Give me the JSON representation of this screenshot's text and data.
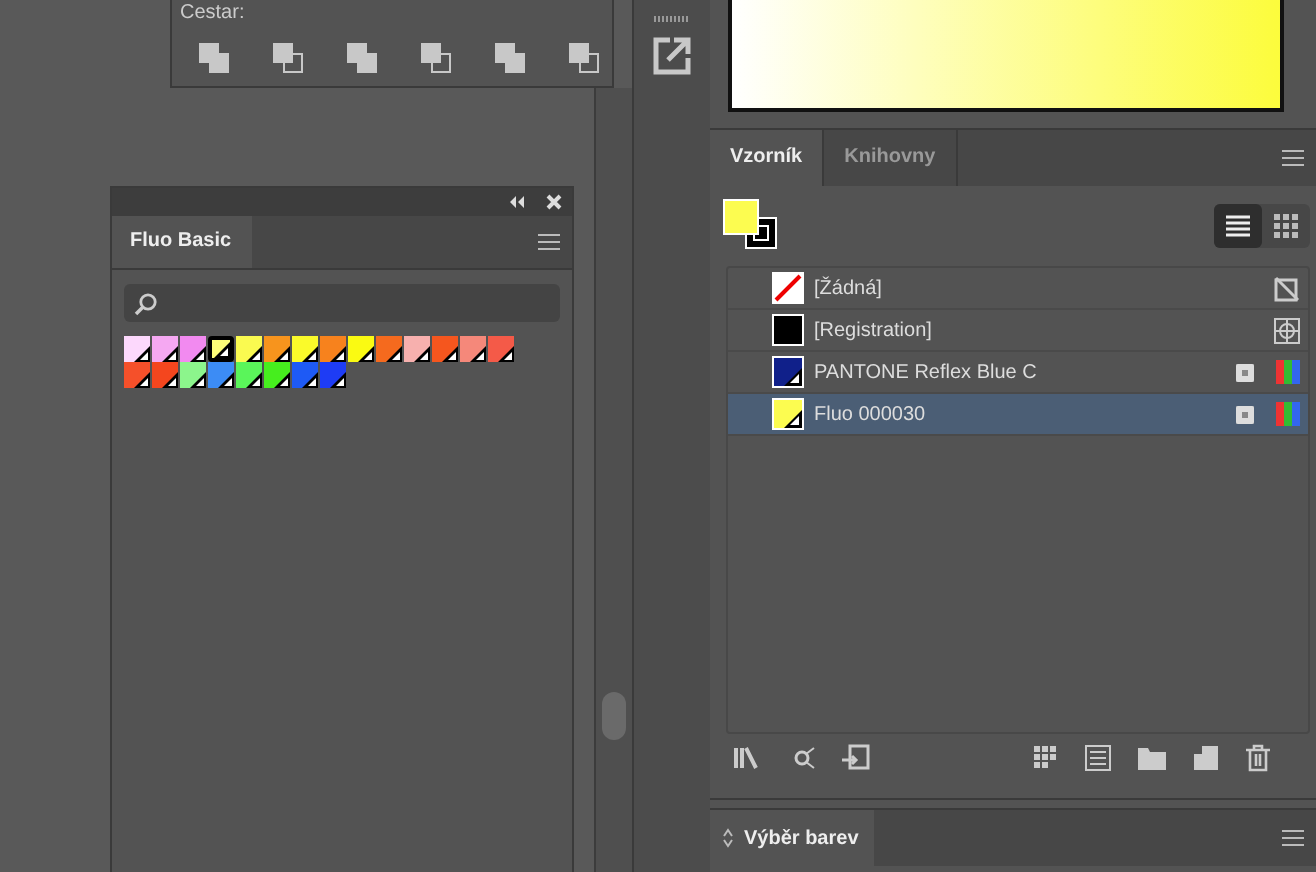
{
  "pathfinder_panel": {
    "label": "Cestar:"
  },
  "fluo_panel": {
    "tab": "Fluo Basic",
    "swatches": [
      {
        "color": "#fcd8fc",
        "selected": false
      },
      {
        "color": "#f5a8f2",
        "selected": false
      },
      {
        "color": "#f28af0",
        "selected": false
      },
      {
        "color": "#fcfc78",
        "selected": true
      },
      {
        "color": "#fafa50",
        "selected": false
      },
      {
        "color": "#f7941d",
        "selected": false
      },
      {
        "color": "#fafa2a",
        "selected": false
      },
      {
        "color": "#f7821d",
        "selected": false
      },
      {
        "color": "#fafa12",
        "selected": false
      },
      {
        "color": "#f56a1e",
        "selected": false
      },
      {
        "color": "#f7b0ae",
        "selected": false
      },
      {
        "color": "#f5561e",
        "selected": false
      },
      {
        "color": "#f5887a",
        "selected": false
      },
      {
        "color": "#f45a48",
        "selected": false
      },
      {
        "color": "#f5502a",
        "selected": false
      },
      {
        "color": "#f4461e",
        "selected": false
      },
      {
        "color": "#8cf58c",
        "selected": false
      },
      {
        "color": "#3c8cf5",
        "selected": false
      },
      {
        "color": "#5af55a",
        "selected": false
      },
      {
        "color": "#46ee1e",
        "selected": false
      },
      {
        "color": "#1e5af5",
        "selected": false
      },
      {
        "color": "#1e3cf5",
        "selected": false
      }
    ]
  },
  "swatches_panel": {
    "tabs": [
      {
        "label": "Vzorník",
        "selected": true
      },
      {
        "label": "Knihovny",
        "selected": false
      }
    ],
    "view": {
      "list_selected": true
    },
    "items": [
      {
        "name": "[Žádná]",
        "kind": "none",
        "color": "#ffffff",
        "selected": false
      },
      {
        "name": "[Registration]",
        "kind": "registration",
        "color": "#000000",
        "selected": false
      },
      {
        "name": "PANTONE Reflex Blue C",
        "kind": "spot",
        "color": "#10208a",
        "selected": false
      },
      {
        "name": "Fluo 000030",
        "kind": "spot",
        "color": "#fcfc50",
        "selected": true
      }
    ]
  },
  "color_picker_panel": {
    "tab": "Výběr barev"
  }
}
